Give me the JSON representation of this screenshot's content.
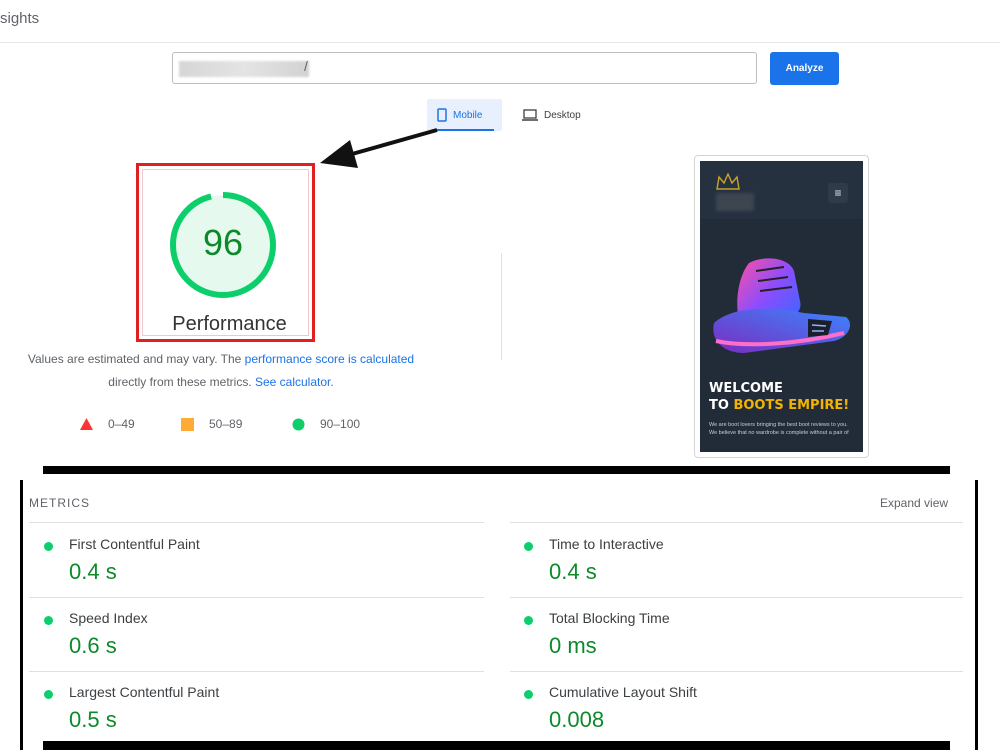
{
  "app": {
    "title": "sights"
  },
  "search": {
    "url_tail": "/",
    "analyze_label": "Analyze"
  },
  "tabs": [
    {
      "label": "Mobile",
      "icon": "phone-icon",
      "selected": true
    },
    {
      "label": "Desktop",
      "icon": "laptop-icon",
      "selected": false
    }
  ],
  "score": {
    "value": "96",
    "label": "Performance",
    "fraction": 0.96
  },
  "note": {
    "text1": "Values are estimated and may vary. The ",
    "link1": "performance score is calculated",
    "text2": "directly from these metrics. ",
    "link2": "See calculator",
    "text3": "."
  },
  "legend": [
    {
      "range": "0–49",
      "shape": "triangle",
      "color": "#ff3333"
    },
    {
      "range": "50–89",
      "shape": "square",
      "color": "#ffaa33"
    },
    {
      "range": "90–100",
      "shape": "circle",
      "color": "#0cce6b"
    }
  ],
  "preview": {
    "welcome_line1": "WELCOME",
    "welcome_to": "TO ",
    "brand": "BOOTS EMPIRE!",
    "body": "We are boot lovers bringing the best boot reviews to you. We believe that no wardrobe is complete without a pair of",
    "menu_icon": "hamburger-icon"
  },
  "metrics": {
    "title": "METRICS",
    "expand_label": "Expand view",
    "items": [
      {
        "name": "First Contentful Paint",
        "value": "0.4 s"
      },
      {
        "name": "Time to Interactive",
        "value": "0.4 s"
      },
      {
        "name": "Speed Index",
        "value": "0.6 s"
      },
      {
        "name": "Total Blocking Time",
        "value": "0 ms"
      },
      {
        "name": "Largest Contentful Paint",
        "value": "0.5 s"
      },
      {
        "name": "Cumulative Layout Shift",
        "value": "0.008"
      }
    ]
  },
  "colors": {
    "accent": "#1a73e8",
    "pass": "#0cce6b",
    "pass_text": "#0c8a2a",
    "highlight_box": "#e02020"
  }
}
